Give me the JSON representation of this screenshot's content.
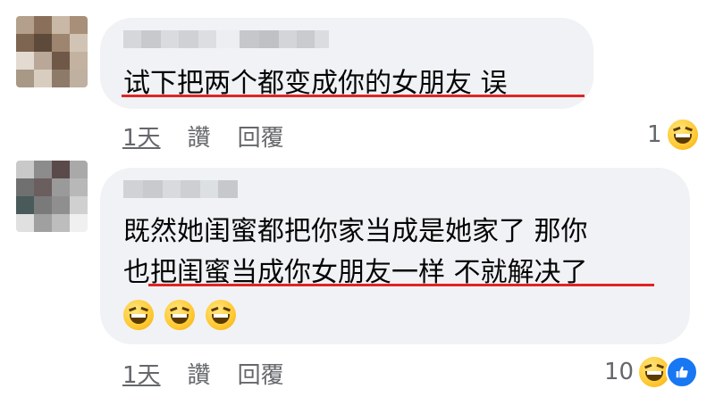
{
  "comments": [
    {
      "text_lines": [
        "试下把两个都变成你的女朋友 误"
      ],
      "timestamp": "1天",
      "like_label": "讚",
      "reply_label": "回覆",
      "reaction_count": "1",
      "reaction_icons": [
        "laughing-emoji"
      ],
      "emojis_in_text": []
    },
    {
      "text_lines": [
        "既然她闺蜜都把你家当成是她家了 那你",
        "也把闺蜜当成你女朋友一样 不就解决了"
      ],
      "timestamp": "1天",
      "like_label": "讚",
      "reply_label": "回覆",
      "reaction_count": "10",
      "reaction_icons": [
        "laughing-emoji",
        "like-icon"
      ],
      "emojis_in_text": [
        "laughing-emoji",
        "laughing-emoji",
        "laughing-emoji"
      ]
    }
  ],
  "colors": {
    "bubble_bg": "#f0f2f5",
    "underline": "#e02424",
    "meta_text": "#65676b",
    "like_blue": "#1877f2"
  }
}
